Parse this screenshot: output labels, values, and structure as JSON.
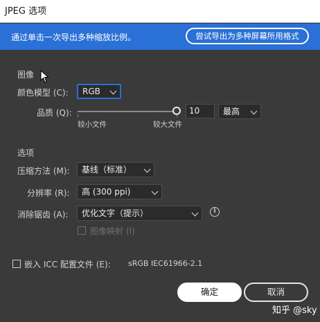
{
  "window": {
    "title": "JPEG 选项"
  },
  "infobar": {
    "text": "通过单击一次导出多种缩放比例。",
    "button_label": "尝试导出为多种屏幕所用格式",
    "color": "#2a70d6"
  },
  "image_section": {
    "heading": "图像",
    "color_model_label": "颜色模型 (C):",
    "color_model_value": "RGB",
    "quality_label": "品质 (Q):",
    "quality_value": "10",
    "quality_level": 1.0,
    "quality_preset": "最高",
    "smaller_file_label": "较小文件",
    "larger_file_label": "较大文件"
  },
  "options_section": {
    "heading": "选项",
    "compression_label": "压缩方法 (M):",
    "compression_value": "基线（标准）",
    "resolution_label": "分辨率 (R):",
    "resolution_value": "高 (300 ppi)",
    "antialias_label": "消除锯齿 (A):",
    "antialias_value": "优化文字（提示）",
    "image_map_label": "图像映射 (I)",
    "info_icon": "info-icon"
  },
  "icc": {
    "label": "嵌入 ICC 配置文件 (E):",
    "profile": "sRGB IEC61966-2.1"
  },
  "buttons": {
    "ok": "确定",
    "cancel": "取消"
  },
  "watermark": "知乎 @sky"
}
